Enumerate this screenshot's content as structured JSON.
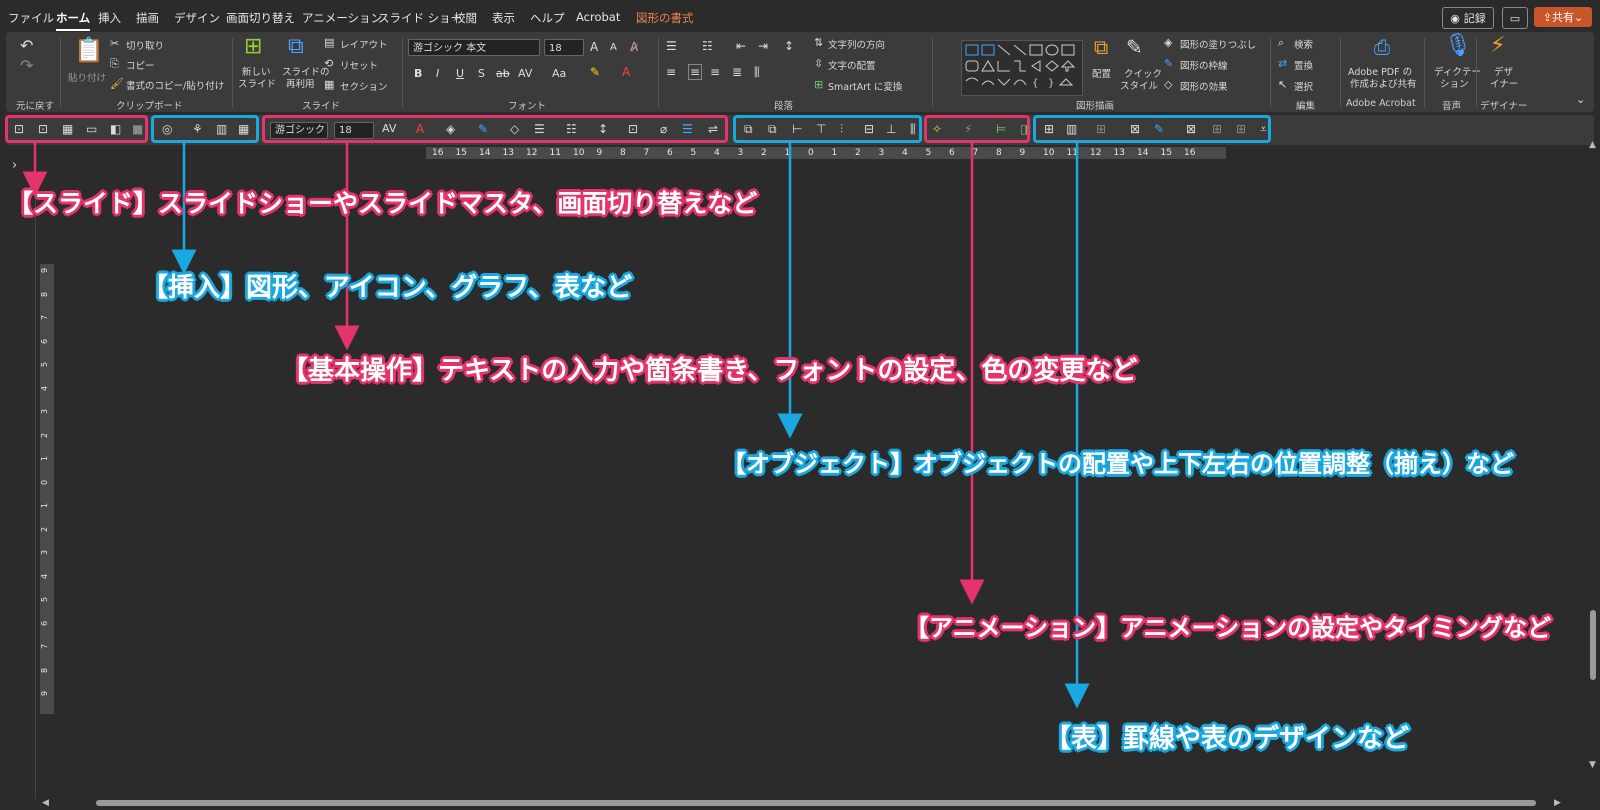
{
  "menu": {
    "tabs": [
      "ファイル",
      "ホーム",
      "挿入",
      "描画",
      "デザイン",
      "画面切り替え",
      "アニメーション",
      "スライド ショー",
      "校閲",
      "表示",
      "ヘルプ",
      "Acrobat",
      "図形の書式"
    ],
    "record": "記録",
    "share": "共有"
  },
  "ribbon": {
    "undo_group": "元に戻す",
    "clipboard": {
      "paste": "貼り付け",
      "cut": "切り取り",
      "copy": "コピー",
      "format_painter": "書式のコピー/貼り付け",
      "group": "クリップボード"
    },
    "slides": {
      "new_slide_1": "新しい",
      "new_slide_2": "スライド",
      "reuse_1": "スライドの",
      "reuse_2": "再利用",
      "layout": "レイアウト",
      "reset": "リセット",
      "section": "セクション",
      "group": "スライド"
    },
    "font": {
      "name": "游ゴシック 本文",
      "size": "18",
      "group": "フォント"
    },
    "paragraph": {
      "text_direction": "文字列の方向",
      "align_text": "文字の配置",
      "smartart": "SmartArt に変換",
      "group": "段落"
    },
    "drawing": {
      "arrange": "配置",
      "quick_styles_1": "クイック",
      "quick_styles_2": "スタイル",
      "fill": "図形の塗りつぶし",
      "outline": "図形の枠線",
      "effects": "図形の効果",
      "group": "図形描画"
    },
    "editing": {
      "find": "検索",
      "replace": "置換",
      "select": "選択",
      "group": "編集"
    },
    "acrobat": {
      "line1": "Adobe PDF の",
      "line2": "作成および共有",
      "group": "Adobe Acrobat"
    },
    "voice": {
      "line1": "ディクテー",
      "line2": "ション",
      "group": "音声"
    },
    "designer": {
      "line1": "デザ",
      "line2": "イナー",
      "group": "デザイナー"
    }
  },
  "quick_toolbar": {
    "font_name": "游ゴシック",
    "font_size": "18"
  },
  "hruler_ticks": [
    "16",
    "15",
    "14",
    "13",
    "12",
    "11",
    "10",
    "9",
    "8",
    "7",
    "6",
    "5",
    "4",
    "3",
    "2",
    "1",
    "0",
    "1",
    "2",
    "3",
    "4",
    "5",
    "6",
    "7",
    "8",
    "9",
    "10",
    "11",
    "12",
    "13",
    "14",
    "15",
    "16"
  ],
  "vruler_ticks": [
    "9",
    "8",
    "7",
    "6",
    "5",
    "4",
    "3",
    "2",
    "1",
    "0",
    "1",
    "2",
    "3",
    "4",
    "5",
    "6",
    "7",
    "8",
    "9"
  ],
  "annotations": {
    "slide": "【スライド】スライドショーやスライドマスタ、画面切り替えなど",
    "insert": "【挿入】図形、アイコン、グラフ、表など",
    "basic": "【基本操作】テキストの入力や箇条書き、フォントの設定、色の変更など",
    "object": "【オブジェクト】オブジェクトの配置や上下左右の位置調整（揃え）など",
    "animation": "【アニメーション】アニメーションの設定やタイミングなど",
    "table": "【表】罫線や表のデザインなど"
  },
  "colors": {
    "pink": "#e5336b",
    "cyan": "#19a8e0",
    "share": "#c9562b",
    "context_tab": "#e8834f"
  }
}
